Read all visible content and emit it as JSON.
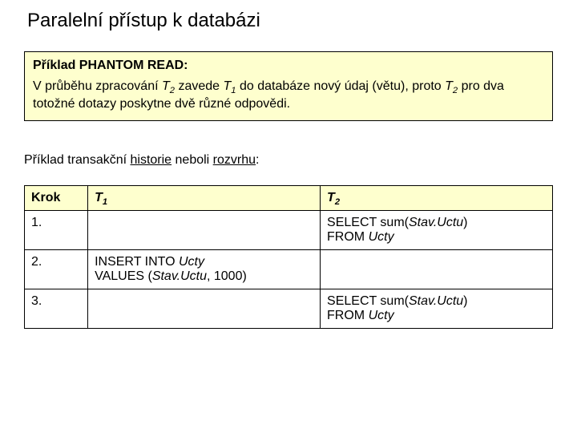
{
  "title": "Paralelní přístup k databázi",
  "box": {
    "heading": "Příklad PHANTOM READ:",
    "body_pre": "V průběhu zpracování ",
    "body_t2a": "T",
    "body_t2a_sub": "2",
    "body_mid1": " zavede ",
    "body_t1": "T",
    "body_t1_sub": "1",
    "body_mid2": " do databáze nový údaj (větu), proto ",
    "body_t2b": "T",
    "body_t2b_sub": "2",
    "body_tail": " pro dva totožné dotazy poskytne dvě různé odpovědi."
  },
  "section": {
    "pre": "Příklad transakční ",
    "w1": "historie",
    "mid": " neboli ",
    "w2": "rozvrhu",
    "post": ":"
  },
  "table": {
    "headers": {
      "step": "Krok",
      "t_letter": "T",
      "t1_sub": "1",
      "t2_sub": "2"
    },
    "rows": [
      {
        "step": "1.",
        "t1": "",
        "t2_pre": "SELECT sum(",
        "t2_it1": "Stav.Uctu",
        "t2_mid": ")\nFROM ",
        "t2_it2": "Ucty",
        "t2_post": ""
      },
      {
        "step": "2.",
        "t1_pre": "INSERT INTO ",
        "t1_it1": "Ucty",
        "t1_mid": "\nVALUES (",
        "t1_it2": "Stav.Uctu",
        "t1_post": ", 1000)",
        "t2": ""
      },
      {
        "step": "3.",
        "t1": "",
        "t2_pre": "SELECT sum(",
        "t2_it1": "Stav.Uctu",
        "t2_mid": ")\nFROM ",
        "t2_it2": "Ucty",
        "t2_post": ""
      }
    ]
  }
}
